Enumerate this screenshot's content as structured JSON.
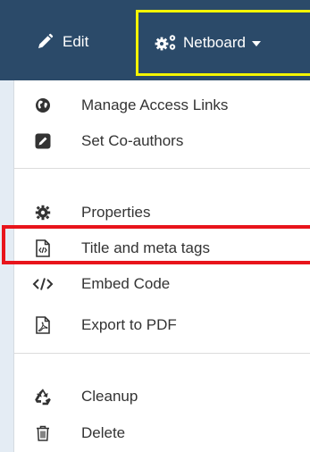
{
  "toolbar": {
    "edit_label": "Edit",
    "netboard_label": "Netboard"
  },
  "menu": {
    "items": [
      {
        "label": "Manage Access Links",
        "icon": "globe-icon"
      },
      {
        "label": "Set Co-authors",
        "icon": "pencil-square-icon"
      },
      {
        "label": "Properties",
        "icon": "gear-icon"
      },
      {
        "label": "Title and meta tags",
        "icon": "code-file-icon"
      },
      {
        "label": "Embed Code",
        "icon": "code-icon"
      },
      {
        "label": "Export to PDF",
        "icon": "pdf-file-icon"
      },
      {
        "label": "Cleanup",
        "icon": "recycle-icon"
      },
      {
        "label": "Delete",
        "icon": "trash-icon"
      }
    ]
  },
  "colors": {
    "toolbar_bg": "#2b4a69",
    "netboard_highlight": "#f5f500",
    "export_highlight": "#e8141b"
  }
}
